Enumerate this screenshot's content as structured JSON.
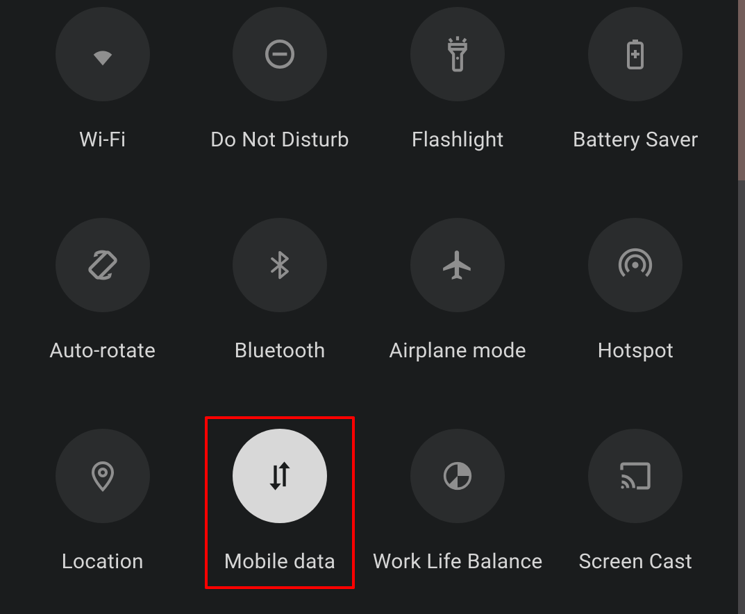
{
  "tiles": [
    {
      "id": "wifi",
      "label": "Wi-Fi",
      "active": false,
      "highlighted": false
    },
    {
      "id": "dnd",
      "label": "Do Not Disturb",
      "active": false,
      "highlighted": false
    },
    {
      "id": "flashlight",
      "label": "Flashlight",
      "active": false,
      "highlighted": false
    },
    {
      "id": "battery-saver",
      "label": "Battery Saver",
      "active": false,
      "highlighted": false
    },
    {
      "id": "auto-rotate",
      "label": "Auto-rotate",
      "active": false,
      "highlighted": false
    },
    {
      "id": "bluetooth",
      "label": "Bluetooth",
      "active": false,
      "highlighted": false
    },
    {
      "id": "airplane",
      "label": "Airplane mode",
      "active": false,
      "highlighted": false
    },
    {
      "id": "hotspot",
      "label": "Hotspot",
      "active": false,
      "highlighted": false
    },
    {
      "id": "location",
      "label": "Location",
      "active": false,
      "highlighted": false
    },
    {
      "id": "mobile-data",
      "label": "Mobile data",
      "active": true,
      "highlighted": true
    },
    {
      "id": "work-life",
      "label": "Work Life Balance",
      "active": false,
      "highlighted": false
    },
    {
      "id": "screen-cast",
      "label": "Screen Cast",
      "active": false,
      "highlighted": false
    }
  ],
  "colors": {
    "background": "#1a1c1d",
    "tile_inactive": "#2a2c2d",
    "tile_active": "#d8d8d8",
    "icon_inactive": "#8f8f8f",
    "icon_active": "#1a1c1d",
    "label": "#d6d6d6",
    "highlight_border": "#ff0100"
  }
}
